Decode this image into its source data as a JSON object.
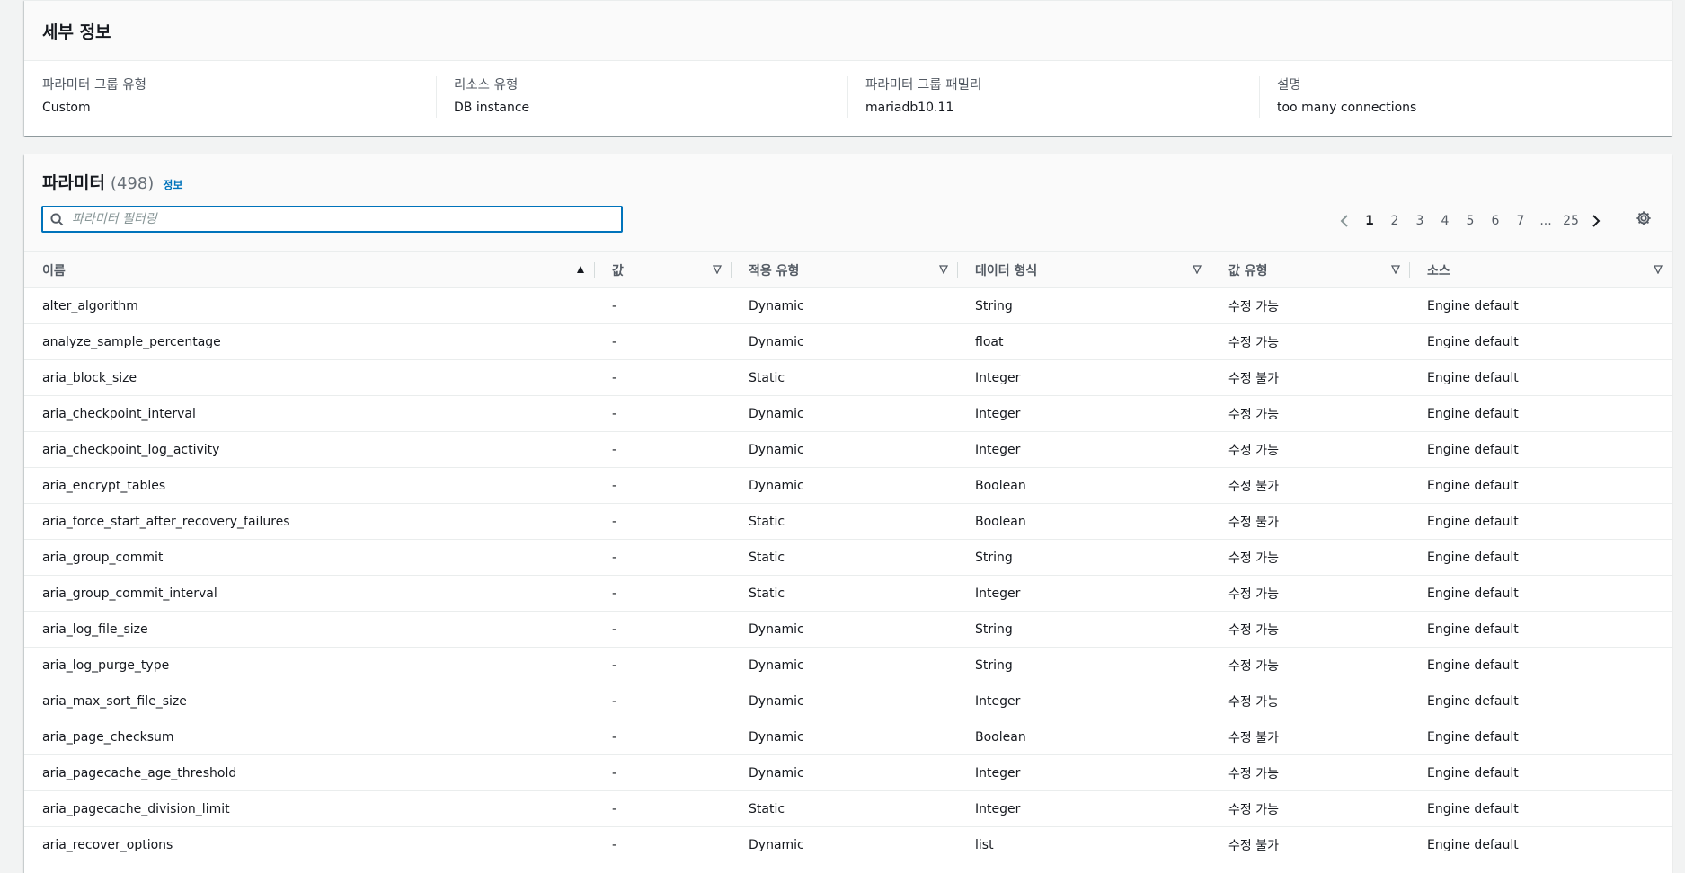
{
  "details": {
    "title": "세부 정보",
    "fields": [
      {
        "label": "파라미터 그룹 유형",
        "value": "Custom"
      },
      {
        "label": "리소스 유형",
        "value": "DB instance"
      },
      {
        "label": "파라미터 그룹 패밀리",
        "value": "mariadb10.11"
      },
      {
        "label": "설명",
        "value": "too many connections"
      }
    ]
  },
  "params": {
    "title": "파라미터",
    "count": "(498)",
    "info": "정보",
    "search_placeholder": "파라미터 필터링",
    "pager": {
      "pages": [
        "1",
        "2",
        "3",
        "4",
        "5",
        "6",
        "7",
        "...",
        "25"
      ],
      "current": "1"
    },
    "columns": [
      "이름",
      "값",
      "적용 유형",
      "데이터 형식",
      "값 유형",
      "소스"
    ],
    "rows": [
      [
        "alter_algorithm",
        "-",
        "Dynamic",
        "String",
        "수정 가능",
        "Engine default"
      ],
      [
        "analyze_sample_percentage",
        "-",
        "Dynamic",
        "float",
        "수정 가능",
        "Engine default"
      ],
      [
        "aria_block_size",
        "-",
        "Static",
        "Integer",
        "수정 불가",
        "Engine default"
      ],
      [
        "aria_checkpoint_interval",
        "-",
        "Dynamic",
        "Integer",
        "수정 가능",
        "Engine default"
      ],
      [
        "aria_checkpoint_log_activity",
        "-",
        "Dynamic",
        "Integer",
        "수정 가능",
        "Engine default"
      ],
      [
        "aria_encrypt_tables",
        "-",
        "Dynamic",
        "Boolean",
        "수정 불가",
        "Engine default"
      ],
      [
        "aria_force_start_after_recovery_failures",
        "-",
        "Static",
        "Boolean",
        "수정 불가",
        "Engine default"
      ],
      [
        "aria_group_commit",
        "-",
        "Static",
        "String",
        "수정 가능",
        "Engine default"
      ],
      [
        "aria_group_commit_interval",
        "-",
        "Static",
        "Integer",
        "수정 가능",
        "Engine default"
      ],
      [
        "aria_log_file_size",
        "-",
        "Dynamic",
        "String",
        "수정 가능",
        "Engine default"
      ],
      [
        "aria_log_purge_type",
        "-",
        "Dynamic",
        "String",
        "수정 가능",
        "Engine default"
      ],
      [
        "aria_max_sort_file_size",
        "-",
        "Dynamic",
        "Integer",
        "수정 가능",
        "Engine default"
      ],
      [
        "aria_page_checksum",
        "-",
        "Dynamic",
        "Boolean",
        "수정 불가",
        "Engine default"
      ],
      [
        "aria_pagecache_age_threshold",
        "-",
        "Dynamic",
        "Integer",
        "수정 가능",
        "Engine default"
      ],
      [
        "aria_pagecache_division_limit",
        "-",
        "Static",
        "Integer",
        "수정 가능",
        "Engine default"
      ],
      [
        "aria_recover_options",
        "-",
        "Dynamic",
        "list",
        "수정 불가",
        "Engine default"
      ]
    ]
  },
  "icons": {
    "search": "search-icon",
    "prev": "chevron-left-icon",
    "next": "chevron-right-icon",
    "settings": "gear-icon",
    "sort_asc": "sort-ascending-icon",
    "sort": "sort-descending-icon"
  },
  "colors": {
    "accent": "#0073bb",
    "background": "#f2f3f3",
    "muted": "#545b64"
  }
}
